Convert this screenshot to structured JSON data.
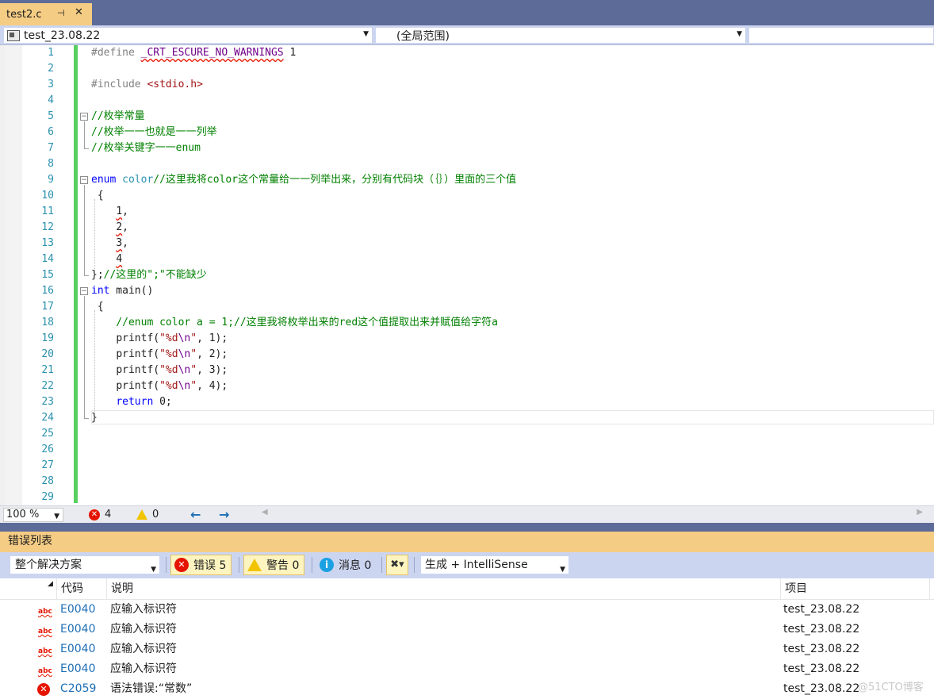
{
  "tab": {
    "title": "test2.c",
    "pin": "⊣",
    "close": "✕"
  },
  "navbar": {
    "project": "test_23.08.22",
    "scope": "(全局范围)"
  },
  "editor": {
    "line_numbers": [
      "1",
      "2",
      "3",
      "4",
      "5",
      "6",
      "7",
      "8",
      "9",
      "10",
      "11",
      "12",
      "13",
      "14",
      "15",
      "16",
      "17",
      "18",
      "19",
      "20",
      "21",
      "22",
      "23",
      "24",
      "25",
      "26",
      "27",
      "28",
      "29"
    ],
    "code": {
      "l1_directive": "#define",
      "l1_macro": "_CRT_ESCURE_NO_WARNINGS",
      "l1_value": " 1",
      "l3_directive": "#include",
      "l3_header": "<stdio.h>",
      "l5": "//枚举常量",
      "l6": "//枚举一一也就是一一列举",
      "l7": "//枚举关键字一一enum",
      "l9_kw": "enum",
      "l9_type": "color",
      "l9_comment": "//这里我将color这个常量给一一列举出来，分别有代码块（｛｝）里面的三个值",
      "l10": "{",
      "l11": "1",
      "l11_rest": ",",
      "l12": "2",
      "l12_rest": ",",
      "l13": "3",
      "l13_rest": ",",
      "l14": "4",
      "l15_brace": "}",
      "l15_semi": ";",
      "l15_comment": "//这里的\";\"不能缺少",
      "l16_kw": "int",
      "l16_rest": " main()",
      "l17": "{",
      "l18": "//enum color a = 1;//这里我将枚举出来的red这个值提取出来并赋值给字符a",
      "l19_fn": "printf(",
      "l19_str": "\"%d",
      "l19_esc": "\\n",
      "l19_str_end": "\"",
      "l19_rest": ", 1);",
      "l20_fn": "printf(",
      "l20_str": "\"%d",
      "l20_esc": "\\n",
      "l20_str_end": "\"",
      "l20_rest": ", 2);",
      "l21_fn": "printf(",
      "l21_str": "\"%d",
      "l21_esc": "\\n",
      "l21_str_end": "\"",
      "l21_rest": ", 3);",
      "l22_fn": "printf(",
      "l22_str": "\"%d",
      "l22_esc": "\\n",
      "l22_str_end": "\"",
      "l22_rest": ", 4);",
      "l23_kw": "return",
      "l23_rest": " 0;",
      "l24": "}"
    }
  },
  "status": {
    "zoom": "100 %",
    "errors": "4",
    "warnings": "0",
    "back": "←",
    "forward": "→"
  },
  "error_panel": {
    "title": "错误列表",
    "scope": "整个解决方案",
    "errors_btn": "错误 5",
    "warnings_btn": "警告 0",
    "messages_btn": "消息 0",
    "build_filter": "生成 + IntelliSense",
    "columns": {
      "code": "代码",
      "description": "说明",
      "project": "项目"
    },
    "rows": [
      {
        "icon": "intellisense-error-icon",
        "code": "E0040",
        "description": "应输入标识符",
        "project": "test_23.08.22"
      },
      {
        "icon": "intellisense-error-icon",
        "code": "E0040",
        "description": "应输入标识符",
        "project": "test_23.08.22"
      },
      {
        "icon": "intellisense-error-icon",
        "code": "E0040",
        "description": "应输入标识符",
        "project": "test_23.08.22"
      },
      {
        "icon": "intellisense-error-icon",
        "code": "E0040",
        "description": "应输入标识符",
        "project": "test_23.08.22"
      },
      {
        "icon": "build-error-icon",
        "code": "C2059",
        "description": "语法错误:“常数”",
        "project": "test_23.08.22"
      }
    ]
  },
  "watermark": "@51CTO博客",
  "colors": {
    "tab_active": "#f5cc84",
    "change_bar": "#57d05f",
    "error": "#e51400",
    "line_number": "#2b91af"
  }
}
